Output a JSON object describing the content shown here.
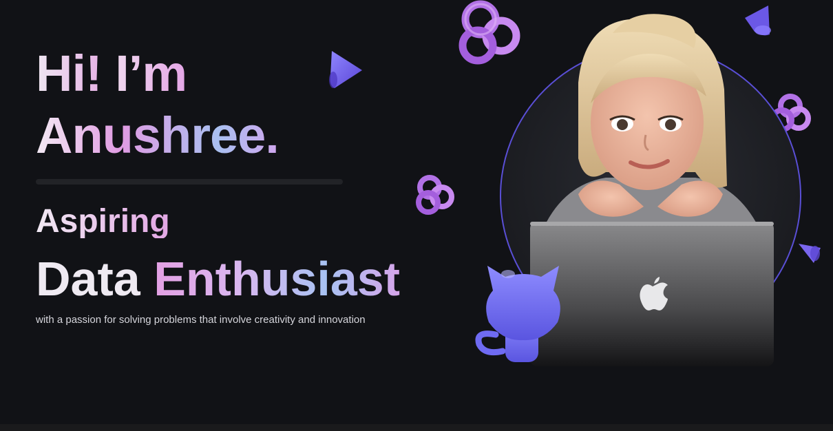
{
  "hero": {
    "greeting_part1": "Hi!",
    "greeting_part2": "I’m",
    "name": "Anushree.",
    "role_prefix": "Aspiring",
    "role_word1": "Data",
    "role_word2": "Enthusiast",
    "tagline": "with a passion for solving problems that involve creativity and innovation"
  },
  "colors": {
    "background": "#111216",
    "accent_pink": "#e4a6e6",
    "accent_blue": "#a9bff0",
    "accent_purple": "#7b6cf0"
  },
  "icons": {
    "decorations": [
      "cone-icon",
      "torus-knot-icon",
      "github-octocat-icon",
      "apple-logo-icon"
    ]
  }
}
